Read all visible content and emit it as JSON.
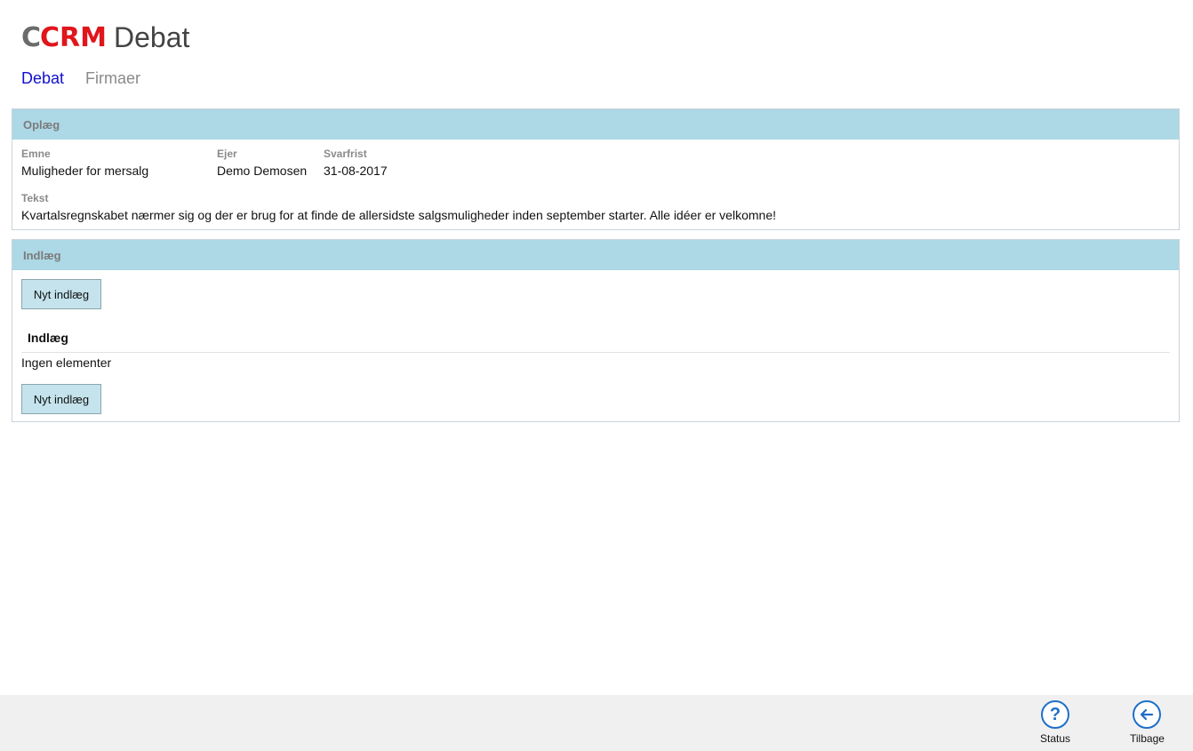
{
  "app": {
    "logo_c": "C",
    "logo_crm": "CRM",
    "title": "Debat"
  },
  "nav": {
    "tabs": [
      {
        "label": "Debat",
        "active": true
      },
      {
        "label": "Firmaer",
        "active": false
      }
    ]
  },
  "oplaeg": {
    "header": "Oplæg",
    "fields": {
      "emne_label": "Emne",
      "emne_value": "Muligheder for mersalg",
      "ejer_label": "Ejer",
      "ejer_value": "Demo Demosen",
      "svarfrist_label": "Svarfrist",
      "svarfrist_value": "31-08-2017",
      "tekst_label": "Tekst",
      "tekst_value": "Kvartalsregnskabet nærmer sig og der er brug for at finde de allersidste salgsmuligheder inden september starter. Alle idéer er velkomne!"
    }
  },
  "indlaeg": {
    "header": "Indlæg",
    "new_button_label": "Nyt indlæg",
    "list_title": "Indlæg",
    "empty_text": "Ingen elementer"
  },
  "footer": {
    "status_label": "Status",
    "back_label": "Tilbage",
    "status_icon": "question-circle-icon",
    "back_icon": "arrow-left-circle-icon",
    "accent_color": "#1e6fc9"
  },
  "colors": {
    "panel_header_bg": "#add8e6",
    "button_bg": "#c4e3ec",
    "active_tab": "#1010d0",
    "logo_red": "#e0161b"
  }
}
